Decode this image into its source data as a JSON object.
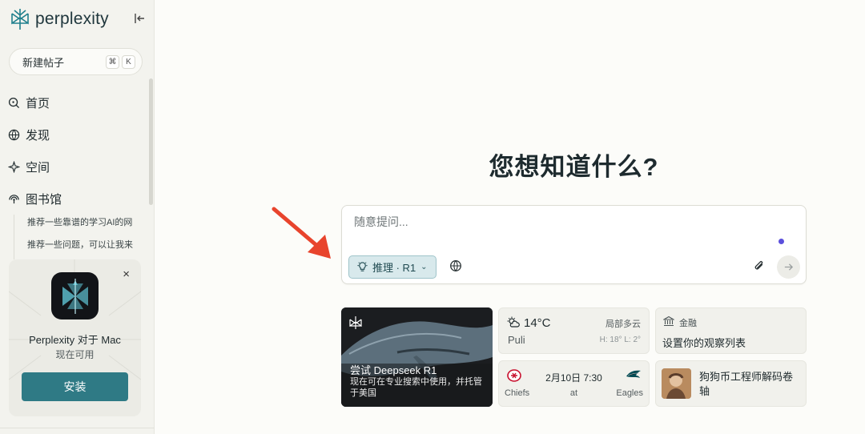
{
  "sidebar": {
    "brand": "perplexity",
    "new_thread": {
      "label": "新建帖子",
      "shortcut": [
        "⌘",
        "K"
      ]
    },
    "nav": [
      {
        "label": "首页",
        "icon": "search-icon"
      },
      {
        "label": "发现",
        "icon": "globe-icon"
      },
      {
        "label": "空间",
        "icon": "sparkle-icon"
      },
      {
        "label": "图书馆",
        "icon": "library-icon"
      }
    ],
    "library_items": [
      "推荐一些靠谱的学习AI的网",
      "推荐一些问题，可以让我来"
    ],
    "promo": {
      "title": "Perplexity 对于 Mac",
      "subtitle": "现在可用",
      "install_label": "安装",
      "close": "×"
    }
  },
  "main": {
    "headline": "您想知道什么?",
    "ask": {
      "placeholder": "随意提问...",
      "mode_label": "推理 · R1"
    },
    "cards": {
      "deepseek": {
        "title": "尝试 Deepseek R1",
        "desc": "现在可在专业搜索中使用，并托管于美国"
      },
      "weather": {
        "temp": "14°C",
        "condition": "局部多云",
        "location": "Puli",
        "hilo": "H: 18° L: 2°"
      },
      "finance": {
        "category": "金融",
        "title": "设置你的观察列表"
      },
      "game": {
        "date": "2月10日 7:30",
        "home": "Chiefs",
        "at": "at",
        "away": "Eagles"
      },
      "news": {
        "title": "狗狗币工程师解码卷轴"
      }
    }
  },
  "colors": {
    "accent": "#2f7a85",
    "annotation_arrow": "#e8442d",
    "dot": "#5b4fdc"
  }
}
